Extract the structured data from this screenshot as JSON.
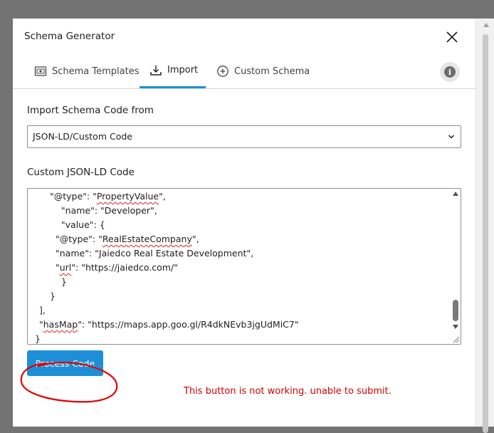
{
  "modal": {
    "title": "Schema Generator"
  },
  "tabs": [
    {
      "label": "Schema Templates",
      "icon": "schema-templates-icon"
    },
    {
      "label": "Import",
      "icon": "import-download-icon",
      "active": true
    },
    {
      "label": "Custom Schema",
      "icon": "plus-circle-icon"
    }
  ],
  "import_section": {
    "label": "Import Schema Code from",
    "select_value": "JSON-LD/Custom Code"
  },
  "code_section": {
    "label": "Custom JSON-LD Code",
    "lines": [
      "    \"@type\": \"PropertyValue\",",
      "    \"name\": \"Developer\",",
      "    \"value\": {",
      "      \"@type\": \"RealEstateCompany\",",
      "      \"name\": \"Jaiedco Real Estate Development\",",
      "      \"url\": \"https://jaiedco.com/\"",
      "    }",
      "  }",
      "],",
      "\"hasMap\": \"https://maps.app.goo.gl/R4dkNEvb3jgUdMiC7\"",
      "}"
    ]
  },
  "actions": {
    "process_label": "Process Code"
  },
  "annotation": {
    "text": "This button is not working. unable to submit.",
    "color": "#d40000"
  },
  "colors": {
    "accent": "#1e8fd6",
    "backdrop": "#737373"
  }
}
